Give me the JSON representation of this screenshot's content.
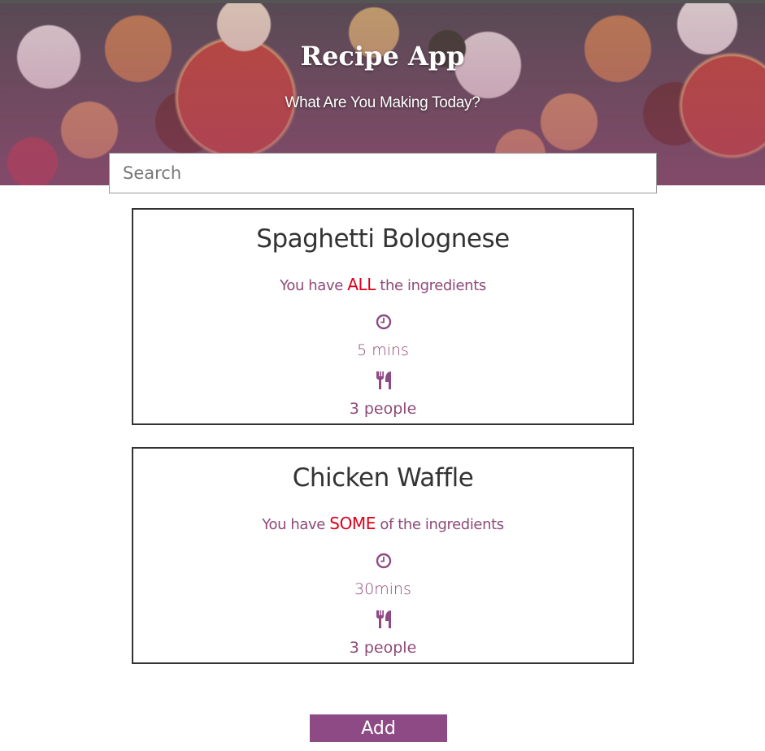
{
  "header": {
    "title": "Recipe App",
    "subtitle": "What Are You Making Today?"
  },
  "search": {
    "placeholder": "Search",
    "value": ""
  },
  "recipes": [
    {
      "name": "Spaghetti Bolognese",
      "status_prefix": "You have ",
      "status_highlight": "ALL",
      "status_suffix": " the ingredients",
      "time": "5 mins",
      "servings": "3 people"
    },
    {
      "name": "Chicken Waffle",
      "status_prefix": "You have ",
      "status_highlight": "SOME",
      "status_suffix": " of the ingredients",
      "time": "30mins",
      "servings": "3 people"
    }
  ],
  "actions": {
    "add_label": "Add"
  },
  "icons": {
    "time": "clock-icon",
    "servings": "cutlery-icon"
  },
  "colors": {
    "accent": "#8e4a85",
    "highlight": "#e0001b",
    "text_purple": "#8e4a78",
    "title_dark": "#333333"
  }
}
